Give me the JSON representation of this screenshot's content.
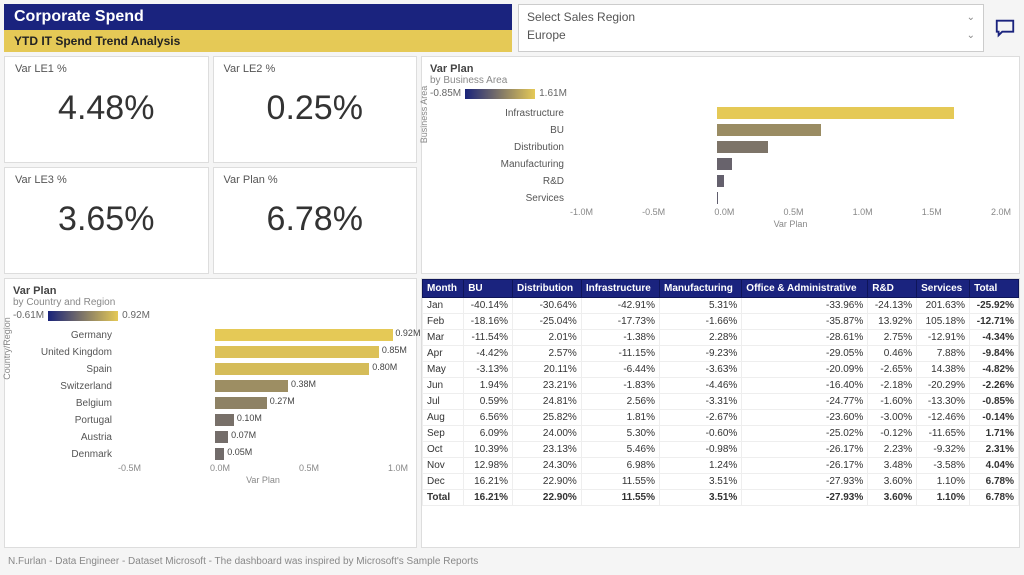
{
  "header": {
    "title": "Corporate Spend",
    "subtitle": "YTD IT Spend Trend Analysis",
    "select_label": "Select Sales Region",
    "select_value": "Europe"
  },
  "kpi": {
    "le1_label": "Var LE1 %",
    "le1_value": "4.48%",
    "le2_label": "Var LE2 %",
    "le2_value": "0.25%",
    "le3_label": "Var LE3 %",
    "le3_value": "3.65%",
    "plan_label": "Var Plan %",
    "plan_value": "6.78%"
  },
  "biz_chart": {
    "title": "Var Plan",
    "sub": "by Business Area",
    "leg_min": "-0.85M",
    "leg_max": "1.61M",
    "ylabel": "Business Area",
    "xlabel": "Var Plan",
    "ticks": [
      "-1.0M",
      "-0.5M",
      "0.0M",
      "0.5M",
      "1.0M",
      "1.5M",
      "2.0M"
    ],
    "rows": [
      {
        "name": "Infrastructure",
        "v": 1.61
      },
      {
        "name": "BU",
        "v": 0.71
      },
      {
        "name": "Distribution",
        "v": 0.35
      },
      {
        "name": "Manufacturing",
        "v": 0.1
      },
      {
        "name": "R&D",
        "v": 0.05
      },
      {
        "name": "Services",
        "v": 0.01
      }
    ]
  },
  "country_chart": {
    "title": "Var Plan",
    "sub": "by Country and Region",
    "leg_min": "-0.61M",
    "leg_max": "0.92M",
    "ylabel": "Country/Region",
    "xlabel": "Var Plan",
    "ticks": [
      "-0.5M",
      "0.0M",
      "0.5M",
      "1.0M"
    ],
    "rows": [
      {
        "name": "Germany",
        "v": 0.92,
        "lbl": "0.92M"
      },
      {
        "name": "United Kingdom",
        "v": 0.85,
        "lbl": "0.85M"
      },
      {
        "name": "Spain",
        "v": 0.8,
        "lbl": "0.80M"
      },
      {
        "name": "Switzerland",
        "v": 0.38,
        "lbl": "0.38M"
      },
      {
        "name": "Belgium",
        "v": 0.27,
        "lbl": "0.27M"
      },
      {
        "name": "Portugal",
        "v": 0.1,
        "lbl": "0.10M"
      },
      {
        "name": "Austria",
        "v": 0.07,
        "lbl": "0.07M"
      },
      {
        "name": "Denmark",
        "v": 0.05,
        "lbl": "0.05M"
      }
    ]
  },
  "table": {
    "headers": [
      "Month",
      "BU",
      "Distribution",
      "Infrastructure",
      "Manufacturing",
      "Office & Administrative",
      "R&D",
      "Services",
      "Total"
    ],
    "rows": [
      [
        "Jan",
        "-40.14%",
        "-30.64%",
        "-42.91%",
        "5.31%",
        "-33.96%",
        "-24.13%",
        "201.63%",
        "-25.92%"
      ],
      [
        "Feb",
        "-18.16%",
        "-25.04%",
        "-17.73%",
        "-1.66%",
        "-35.87%",
        "13.92%",
        "105.18%",
        "-12.71%"
      ],
      [
        "Mar",
        "-11.54%",
        "2.01%",
        "-1.38%",
        "2.28%",
        "-28.61%",
        "2.75%",
        "-12.91%",
        "-4.34%"
      ],
      [
        "Apr",
        "-4.42%",
        "2.57%",
        "-11.15%",
        "-9.23%",
        "-29.05%",
        "0.46%",
        "7.88%",
        "-9.84%"
      ],
      [
        "May",
        "-3.13%",
        "20.11%",
        "-6.44%",
        "-3.63%",
        "-20.09%",
        "-2.65%",
        "14.38%",
        "-4.82%"
      ],
      [
        "Jun",
        "1.94%",
        "23.21%",
        "-1.83%",
        "-4.46%",
        "-16.40%",
        "-2.18%",
        "-20.29%",
        "-2.26%"
      ],
      [
        "Jul",
        "0.59%",
        "24.81%",
        "2.56%",
        "-3.31%",
        "-24.77%",
        "-1.60%",
        "-13.30%",
        "-0.85%"
      ],
      [
        "Aug",
        "6.56%",
        "25.82%",
        "1.81%",
        "-2.67%",
        "-23.60%",
        "-3.00%",
        "-12.46%",
        "-0.14%"
      ],
      [
        "Sep",
        "6.09%",
        "24.00%",
        "5.30%",
        "-0.60%",
        "-25.02%",
        "-0.12%",
        "-11.65%",
        "1.71%"
      ],
      [
        "Oct",
        "10.39%",
        "23.13%",
        "5.46%",
        "-0.98%",
        "-26.17%",
        "2.23%",
        "-9.32%",
        "2.31%"
      ],
      [
        "Nov",
        "12.98%",
        "24.30%",
        "6.98%",
        "1.24%",
        "-26.17%",
        "3.48%",
        "-3.58%",
        "4.04%"
      ],
      [
        "Dec",
        "16.21%",
        "22.90%",
        "11.55%",
        "3.51%",
        "-27.93%",
        "3.60%",
        "1.10%",
        "6.78%"
      ]
    ],
    "total": [
      "Total",
      "16.21%",
      "22.90%",
      "11.55%",
      "3.51%",
      "-27.93%",
      "3.60%",
      "1.10%",
      "6.78%"
    ]
  },
  "footer": "N.Furlan - Data Engineer - Dataset Microsoft - The dashboard was inspired by Microsoft's Sample Reports",
  "chart_data": [
    {
      "type": "bar",
      "orientation": "horizontal",
      "title": "Var Plan by Business Area",
      "xlabel": "Var Plan",
      "ylabel": "Business Area",
      "xlim": [
        -1.0,
        2.0
      ],
      "categories": [
        "Infrastructure",
        "BU",
        "Distribution",
        "Manufacturing",
        "R&D",
        "Services"
      ],
      "values": [
        1.61,
        0.71,
        0.35,
        0.1,
        0.05,
        0.01
      ],
      "color_scale": {
        "min": -0.85,
        "max": 1.61
      }
    },
    {
      "type": "bar",
      "orientation": "horizontal",
      "title": "Var Plan by Country and Region",
      "xlabel": "Var Plan",
      "ylabel": "Country/Region",
      "xlim": [
        -0.5,
        1.0
      ],
      "categories": [
        "Germany",
        "United Kingdom",
        "Spain",
        "Switzerland",
        "Belgium",
        "Portugal",
        "Austria",
        "Denmark"
      ],
      "values": [
        0.92,
        0.85,
        0.8,
        0.38,
        0.27,
        0.1,
        0.07,
        0.05
      ],
      "color_scale": {
        "min": -0.61,
        "max": 0.92
      }
    },
    {
      "type": "table",
      "title": "Monthly variance by business area",
      "columns": [
        "Month",
        "BU",
        "Distribution",
        "Infrastructure",
        "Manufacturing",
        "Office & Administrative",
        "R&D",
        "Services",
        "Total"
      ],
      "rows": [
        [
          "Jan",
          -40.14,
          -30.64,
          -42.91,
          5.31,
          -33.96,
          -24.13,
          201.63,
          -25.92
        ],
        [
          "Feb",
          -18.16,
          -25.04,
          -17.73,
          -1.66,
          -35.87,
          13.92,
          105.18,
          -12.71
        ],
        [
          "Mar",
          -11.54,
          2.01,
          -1.38,
          2.28,
          -28.61,
          2.75,
          -12.91,
          -4.34
        ],
        [
          "Apr",
          -4.42,
          2.57,
          -11.15,
          -9.23,
          -29.05,
          0.46,
          7.88,
          -9.84
        ],
        [
          "May",
          -3.13,
          20.11,
          -6.44,
          -3.63,
          -20.09,
          -2.65,
          14.38,
          -4.82
        ],
        [
          "Jun",
          1.94,
          23.21,
          -1.83,
          -4.46,
          -16.4,
          -2.18,
          -20.29,
          -2.26
        ],
        [
          "Jul",
          0.59,
          24.81,
          2.56,
          -3.31,
          -24.77,
          -1.6,
          -13.3,
          -0.85
        ],
        [
          "Aug",
          6.56,
          25.82,
          1.81,
          -2.67,
          -23.6,
          -3.0,
          -12.46,
          -0.14
        ],
        [
          "Sep",
          6.09,
          24.0,
          5.3,
          -0.6,
          -25.02,
          -0.12,
          -11.65,
          1.71
        ],
        [
          "Oct",
          10.39,
          23.13,
          5.46,
          -0.98,
          -26.17,
          2.23,
          -9.32,
          2.31
        ],
        [
          "Nov",
          12.98,
          24.3,
          6.98,
          1.24,
          -26.17,
          3.48,
          -3.58,
          4.04
        ],
        [
          "Dec",
          16.21,
          22.9,
          11.55,
          3.51,
          -27.93,
          3.6,
          1.1,
          6.78
        ],
        [
          "Total",
          16.21,
          22.9,
          11.55,
          3.51,
          -27.93,
          3.6,
          1.1,
          6.78
        ]
      ]
    }
  ]
}
